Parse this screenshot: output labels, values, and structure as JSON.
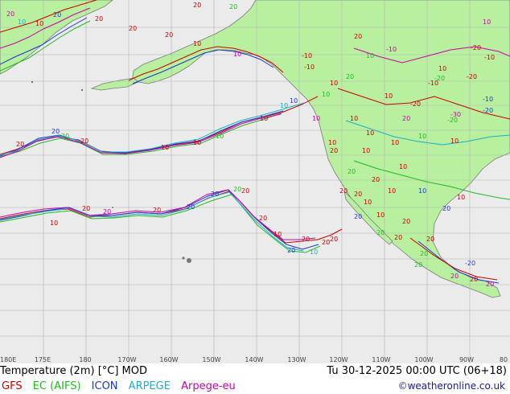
{
  "map": {
    "colors": {
      "sea": "#ebebeb",
      "land": "#b8f0a0",
      "grid": "#b3b3b3",
      "coast": "#7a7a7a",
      "gfs": "#cc0000",
      "ec": "#22bb22",
      "icon": "#1a3acc",
      "arpege": "#1ab0c8",
      "arpege_eu": "#cc00aa"
    },
    "lon_labels": [
      "180E",
      "175E",
      "180",
      "170W",
      "160W",
      "150W",
      "140W",
      "130W",
      "120W",
      "110W",
      "100W",
      "90W",
      "80"
    ],
    "contour_labels": [
      {
        "text": "20",
        "color": "#cc0000"
      },
      {
        "text": "20",
        "color": "#22bb22"
      },
      {
        "text": "20",
        "color": "#cc00aa"
      },
      {
        "text": "10",
        "color": "#1ab0c8"
      },
      {
        "text": "10",
        "color": "#cc0000"
      },
      {
        "text": "20",
        "color": "#1a3acc"
      },
      {
        "text": "20",
        "color": "#cc0000"
      },
      {
        "text": "20",
        "color": "#cc0000"
      },
      {
        "text": "20",
        "color": "#cc0000"
      },
      {
        "text": "10",
        "color": "#cc0000"
      },
      {
        "text": "10",
        "color": "#cc00aa"
      },
      {
        "text": "-10",
        "color": "#cc0000"
      },
      {
        "text": "20",
        "color": "#cc0000"
      },
      {
        "text": "10",
        "color": "#22bb22"
      },
      {
        "text": "10",
        "color": "#cc0000"
      },
      {
        "text": "-20",
        "color": "#cc0000"
      },
      {
        "text": "-20",
        "color": "#22bb22"
      },
      {
        "text": "-10",
        "color": "#cc00aa"
      },
      {
        "text": "20",
        "color": "#22bb22"
      },
      {
        "text": "10",
        "color": "#cc0000"
      },
      {
        "text": "-20",
        "color": "#cc0000"
      },
      {
        "text": "-30",
        "color": "#cc00aa"
      },
      {
        "text": "-20",
        "color": "#1a3acc"
      },
      {
        "text": "20",
        "color": "#cc00aa"
      },
      {
        "text": "10",
        "color": "#cc0000"
      },
      {
        "text": "10",
        "color": "#cc0000"
      },
      {
        "text": "10",
        "color": "#cc0000"
      },
      {
        "text": "10",
        "color": "#22bb22"
      },
      {
        "text": "10",
        "color": "#cc0000"
      },
      {
        "text": "10",
        "color": "#cc0000"
      },
      {
        "text": "10",
        "color": "#1ab0c8"
      },
      {
        "text": "10",
        "color": "#1a3acc"
      },
      {
        "text": "10",
        "color": "#cc0000"
      },
      {
        "text": "10",
        "color": "#cc0000"
      },
      {
        "text": "10",
        "color": "#cc0000"
      },
      {
        "text": "10",
        "color": "#22bb22"
      },
      {
        "text": "20",
        "color": "#cc0000"
      },
      {
        "text": "20",
        "color": "#22bb22"
      },
      {
        "text": "20",
        "color": "#1a3acc"
      },
      {
        "text": "20",
        "color": "#cc0000"
      },
      {
        "text": "20",
        "color": "#cc0000"
      },
      {
        "text": "20",
        "color": "#22bb22"
      },
      {
        "text": "20",
        "color": "#1a3acc"
      },
      {
        "text": "20",
        "color": "#1a3acc"
      },
      {
        "text": "20",
        "color": "#cc0000"
      },
      {
        "text": "20",
        "color": "#cc00aa"
      },
      {
        "text": "20",
        "color": "#cc0000"
      },
      {
        "text": "10",
        "color": "#cc0000"
      },
      {
        "text": "20",
        "color": "#cc0000"
      },
      {
        "text": "10",
        "color": "#cc0000"
      },
      {
        "text": "20",
        "color": "#cc0000"
      },
      {
        "text": "10",
        "color": "#1ab0c8"
      },
      {
        "text": "20",
        "color": "#cc0000"
      },
      {
        "text": "20",
        "color": "#1a3acc"
      },
      {
        "text": "20",
        "color": "#cc0000"
      },
      {
        "text": "20",
        "color": "#1a3acc"
      },
      {
        "text": "20",
        "color": "#22bb22"
      },
      {
        "text": "20",
        "color": "#cc0000"
      },
      {
        "text": "20",
        "color": "#cc0000"
      },
      {
        "text": "10",
        "color": "#cc0000"
      },
      {
        "text": "10",
        "color": "#1a3acc"
      },
      {
        "text": "10",
        "color": "#cc0000"
      },
      {
        "text": "20",
        "color": "#1a3acc"
      },
      {
        "text": "20",
        "color": "#cc0000"
      },
      {
        "text": "20",
        "color": "#cc0000"
      },
      {
        "text": "10",
        "color": "#cc00aa"
      },
      {
        "text": "-10",
        "color": "#cc0000"
      },
      {
        "text": "-20",
        "color": "#cc0000"
      },
      {
        "text": "-10",
        "color": "#1a3acc"
      },
      {
        "text": "-20",
        "color": "#22bb22"
      },
      {
        "text": "-10",
        "color": "#cc0000"
      },
      {
        "text": "10",
        "color": "#cc0000"
      },
      {
        "text": "20",
        "color": "#cc0000"
      },
      {
        "text": "20",
        "color": "#22bb22"
      },
      {
        "text": "20",
        "color": "#22bb22"
      },
      {
        "text": "20",
        "color": "#cc00aa"
      },
      {
        "text": "20",
        "color": "#cc00aa"
      },
      {
        "text": "-20",
        "color": "#1a3acc"
      },
      {
        "text": "20",
        "color": "#cc0000"
      },
      {
        "text": "20",
        "color": "#cc0000"
      },
      {
        "text": "20",
        "color": "#22bb22"
      },
      {
        "text": "10",
        "color": "#cc0000"
      },
      {
        "text": "10",
        "color": "#cc00aa"
      },
      {
        "text": "10",
        "color": "#22bb22"
      },
      {
        "text": "-10",
        "color": "#cc0000"
      },
      {
        "text": "10",
        "color": "#cc0000"
      },
      {
        "text": "10",
        "color": "#cc0000"
      },
      {
        "text": "10",
        "color": "#cc0000"
      },
      {
        "text": "20",
        "color": "#cc0000"
      }
    ]
  },
  "footer": {
    "title": "Temperature (2m) [°C] MOD",
    "timestamp": "Tu 30-12-2025 00:00 UTC (06+18)",
    "legend": [
      {
        "label": "GFS",
        "color": "#cc0000"
      },
      {
        "label": "EC (AIFS)",
        "color": "#22bb22"
      },
      {
        "label": "ICON",
        "color": "#1a3acc"
      },
      {
        "label": "ARPEGE",
        "color": "#1ab0c8"
      },
      {
        "label": "Arpege-eu",
        "color": "#cc00aa"
      }
    ],
    "credit": "©weatheronline.co.uk"
  }
}
